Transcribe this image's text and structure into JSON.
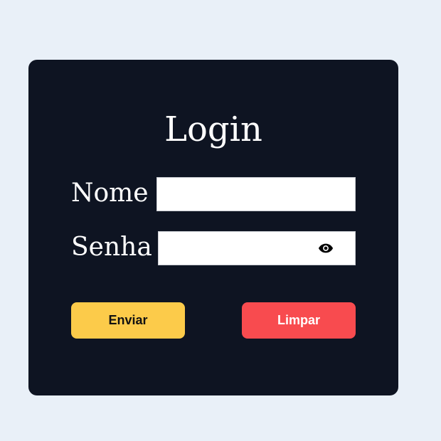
{
  "form": {
    "title": "Login",
    "fields": {
      "name_label": "Nome",
      "name_value": "",
      "password_label": "Senha",
      "password_value": ""
    },
    "password_toggle_icon": "eye-icon",
    "buttons": {
      "submit_label": "Enviar",
      "clear_label": "Limpar"
    }
  },
  "colors": {
    "page_background": "#e9f0f8",
    "card_background": "#0e1422",
    "submit_button": "#fccb4a",
    "clear_button": "#f84b4f"
  }
}
